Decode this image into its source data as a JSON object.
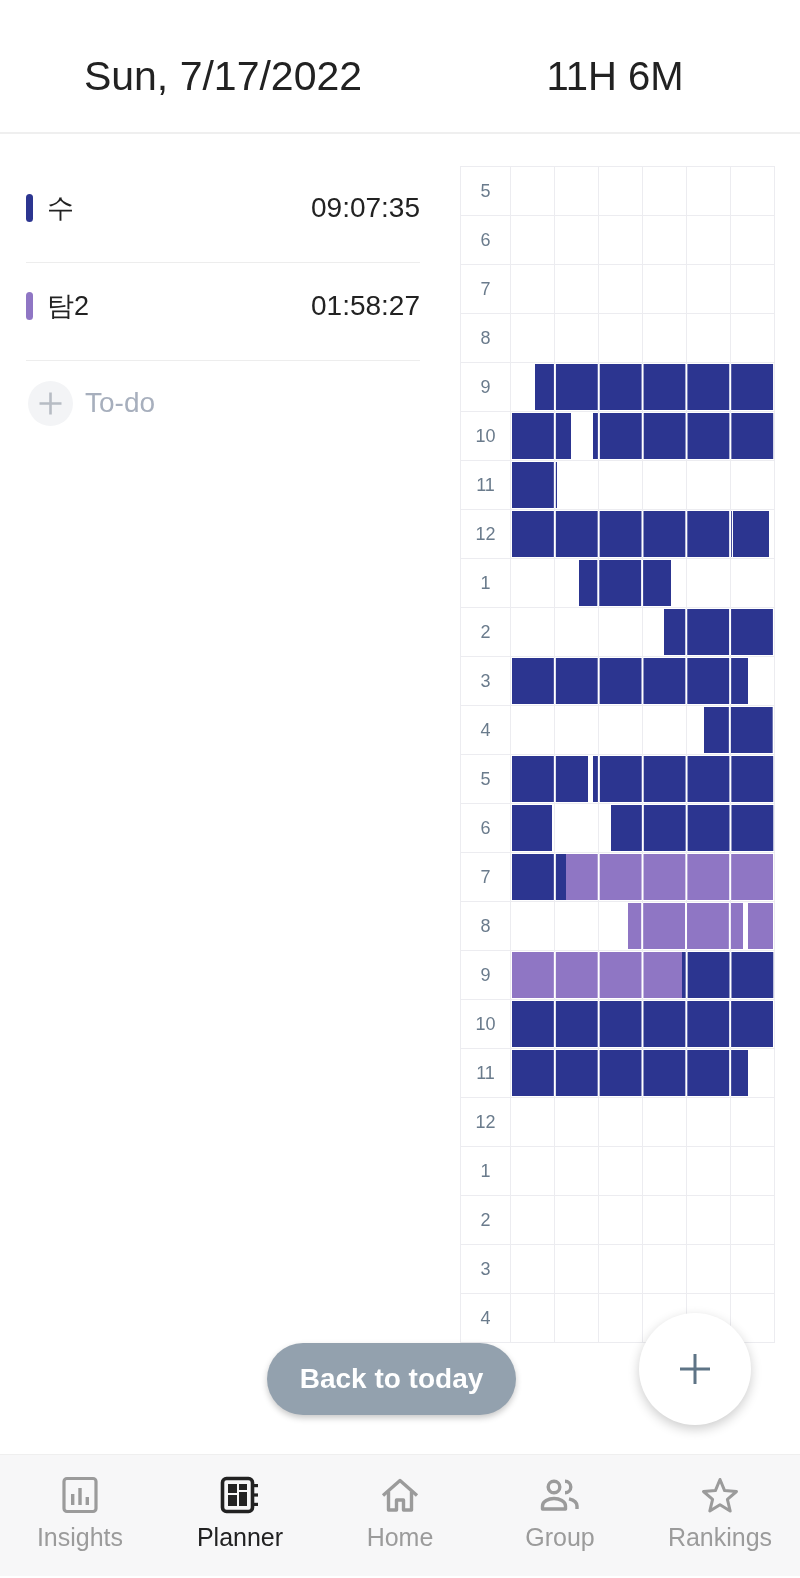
{
  "header": {
    "date": "Sun, 7/17/2022",
    "total_time": "11H 6M"
  },
  "subjects": [
    {
      "name": "수",
      "time": "09:07:35",
      "color": "#2c3590"
    },
    {
      "name": "탐2",
      "time": "01:58:27",
      "color": "#8f76c4"
    }
  ],
  "todo_button": {
    "label": "To-do"
  },
  "timeline": [
    {
      "hour": "5"
    },
    {
      "hour": "6"
    },
    {
      "hour": "7"
    },
    {
      "hour": "8"
    },
    {
      "hour": "9",
      "blocks": [
        {
          "color": "#2c3590"
        }
      ]
    },
    {
      "hour": "10",
      "blocks": [
        {
          "color": "#2c3590"
        },
        {
          "color": "#2c3590"
        }
      ]
    },
    {
      "hour": "11",
      "blocks": [
        {
          "color": "#2c3590"
        }
      ]
    },
    {
      "hour": "12",
      "blocks": [
        {
          "color": "#2c3590"
        },
        {
          "color": "#2c3590"
        }
      ]
    },
    {
      "hour": "1",
      "blocks": [
        {
          "color": "#2c3590"
        }
      ]
    },
    {
      "hour": "2",
      "blocks": [
        {
          "color": "#2c3590"
        }
      ]
    },
    {
      "hour": "3",
      "blocks": [
        {
          "color": "#2c3590"
        }
      ]
    },
    {
      "hour": "4",
      "blocks": [
        {
          "color": "#2c3590"
        }
      ]
    },
    {
      "hour": "5",
      "blocks": [
        {
          "color": "#2c3590"
        },
        {
          "color": "#2c3590"
        }
      ]
    },
    {
      "hour": "6",
      "blocks": [
        {
          "color": "#2c3590"
        },
        {
          "color": "#2c3590"
        }
      ]
    },
    {
      "hour": "7",
      "blocks": [
        {
          "color": "#2c3590"
        },
        {
          "color": "#8f76c4"
        }
      ]
    },
    {
      "hour": "8",
      "blocks": [
        {
          "color": "#8f76c4"
        },
        {
          "color": "#8f76c4"
        }
      ]
    },
    {
      "hour": "9",
      "blocks": [
        {
          "color": "#8f76c4"
        },
        {
          "color": "#2c3590"
        }
      ]
    },
    {
      "hour": "10",
      "blocks": [
        {
          "color": "#2c3590"
        }
      ]
    },
    {
      "hour": "11",
      "blocks": [
        {
          "color": "#2c3590"
        }
      ]
    },
    {
      "hour": "12"
    },
    {
      "hour": "1"
    },
    {
      "hour": "2"
    },
    {
      "hour": "3"
    },
    {
      "hour": "4"
    }
  ],
  "back_button": {
    "label": "Back to today"
  },
  "nav": [
    {
      "label": "Insights",
      "selected": false
    },
    {
      "label": "Planner",
      "selected": true
    },
    {
      "label": "Home",
      "selected": false
    },
    {
      "label": "Group",
      "selected": false
    },
    {
      "label": "Rankings",
      "selected": false
    }
  ]
}
